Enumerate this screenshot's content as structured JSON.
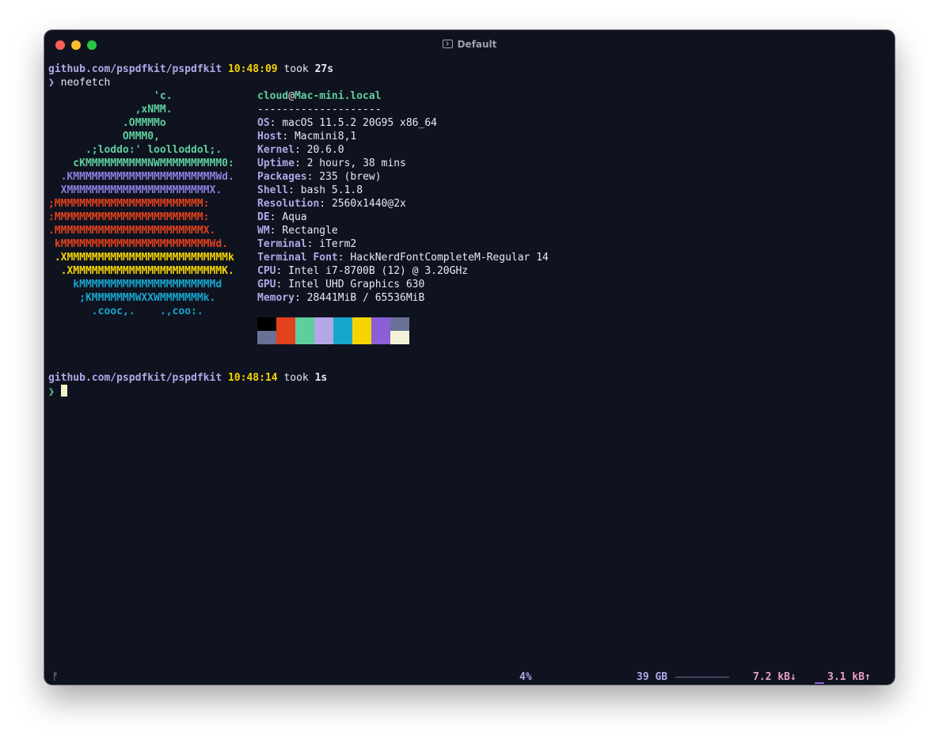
{
  "window": {
    "title": "Default"
  },
  "session1": {
    "path": "github.com/pspdfkit/pspdfkit",
    "time": "10:48:09",
    "took": "took",
    "duration": "27s",
    "prompt": "❯",
    "command": "neofetch"
  },
  "logo_lines": [
    {
      "text": "                 'c.",
      "color": "green"
    },
    {
      "text": "              ,xNMM.",
      "color": "green"
    },
    {
      "text": "            .OMMMMo",
      "color": "green"
    },
    {
      "text": "            OMMM0,",
      "color": "green"
    },
    {
      "text": "      .;loddo:' loolloddol;.",
      "color": "green"
    },
    {
      "text": "    cKMMMMMMMMMMNWMMMMMMMMMM0:",
      "color": "green"
    },
    {
      "text": "  .KMMMMMMMMMMMMMMMMMMMMMMMWd.",
      "color": "purple"
    },
    {
      "text": "  XMMMMMMMMMMMMMMMMMMMMMMMX.",
      "color": "purple"
    },
    {
      "text": ";MMMMMMMMMMMMMMMMMMMMMMMM:",
      "color": "red"
    },
    {
      "text": ":MMMMMMMMMMMMMMMMMMMMMMMM:",
      "color": "red"
    },
    {
      "text": ".MMMMMMMMMMMMMMMMMMMMMMMMX.",
      "color": "red"
    },
    {
      "text": " kMMMMMMMMMMMMMMMMMMMMMMMMWd.",
      "color": "red"
    },
    {
      "text": " .XMMMMMMMMMMMMMMMMMMMMMMMMMMk",
      "color": "yellow"
    },
    {
      "text": "  .XMMMMMMMMMMMMMMMMMMMMMMMMK.",
      "color": "yellow"
    },
    {
      "text": "    kMMMMMMMMMMMMMMMMMMMMMMd",
      "color": "blue"
    },
    {
      "text": "     ;KMMMMMMMWXXWMMMMMMMk.",
      "color": "blue"
    },
    {
      "text": "       .cooc,.    .,coo:.",
      "color": "blue"
    }
  ],
  "info": {
    "user": "cloud",
    "at": "@",
    "host": "Mac-mini.local",
    "separator": "--------------------",
    "rows": [
      {
        "key": "OS",
        "value": "macOS 11.5.2 20G95 x86_64"
      },
      {
        "key": "Host",
        "value": "Macmini8,1"
      },
      {
        "key": "Kernel",
        "value": "20.6.0"
      },
      {
        "key": "Uptime",
        "value": "2 hours, 38 mins"
      },
      {
        "key": "Packages",
        "value": "235 (brew)"
      },
      {
        "key": "Shell",
        "value": "bash 5.1.8"
      },
      {
        "key": "Resolution",
        "value": "2560x1440@2x"
      },
      {
        "key": "DE",
        "value": "Aqua"
      },
      {
        "key": "WM",
        "value": "Rectangle"
      },
      {
        "key": "Terminal",
        "value": "iTerm2"
      },
      {
        "key": "Terminal Font",
        "value": "HackNerdFontCompleteM-Regular 14"
      },
      {
        "key": "CPU",
        "value": "Intel i7-8700B (12) @ 3.20GHz"
      },
      {
        "key": "GPU",
        "value": "Intel UHD Graphics 630"
      },
      {
        "key": "Memory",
        "value": "28441MiB / 65536MiB"
      }
    ]
  },
  "palette": {
    "top": [
      "#000000",
      "#e2411c",
      "#5fce9d",
      "#b3a7e6",
      "#17a6cc",
      "#f5d400",
      "#8b5fd6",
      "#6a7197"
    ],
    "bottom": [
      "#6a7197",
      "#e2411c",
      "#5fce9d",
      "#b3a7e6",
      "#17a6cc",
      "#f5d400",
      "#8b5fd6",
      "#f2f2d8"
    ]
  },
  "session2": {
    "path": "github.com/pspdfkit/pspdfkit",
    "time": "10:48:14",
    "took": "took",
    "duration": "1s",
    "prompt": "❯"
  },
  "statusbar": {
    "git_icon": "git-branch-icon",
    "cpu_icon": "cpu-icon",
    "cpu": "4%",
    "mem_icon": "memory-icon",
    "memory": "39 GB",
    "net_icon": "network-icon",
    "download": "7.2 kB↓",
    "upload": "3.1 kB↑"
  }
}
